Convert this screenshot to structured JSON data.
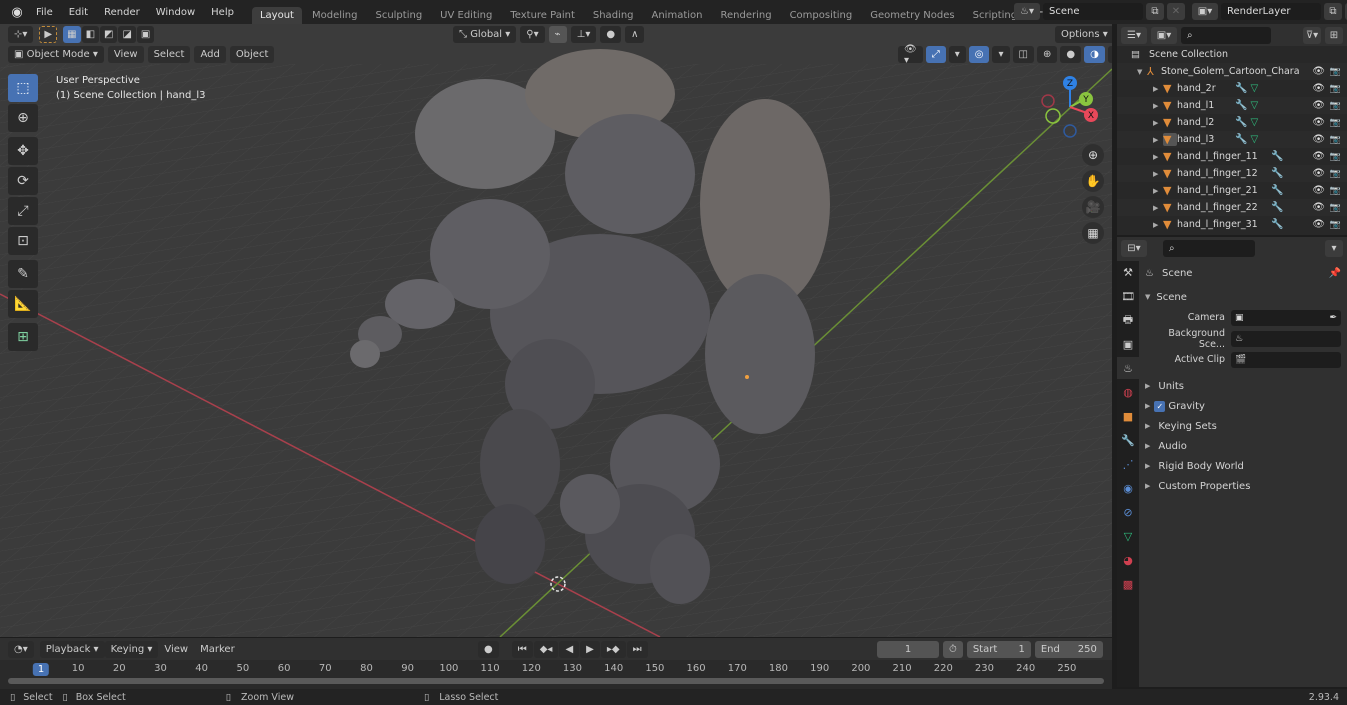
{
  "topbar": {
    "logo": "blender-logo",
    "menus": [
      "File",
      "Edit",
      "Render",
      "Window",
      "Help"
    ],
    "workspaces": [
      "Layout",
      "Modeling",
      "Sculpting",
      "UV Editing",
      "Texture Paint",
      "Shading",
      "Animation",
      "Rendering",
      "Compositing",
      "Geometry Nodes",
      "Scripting"
    ],
    "active_workspace": "Layout",
    "add_workspace": "+",
    "scene_name": "Scene",
    "view_layer": "RenderLayer"
  },
  "viewport": {
    "mode": "Object Mode",
    "menus": [
      "View",
      "Select",
      "Add",
      "Object"
    ],
    "transform_orientation": "Global",
    "options_label": "Options",
    "overlay_line1": "User Perspective",
    "overlay_line2": "(1) Scene Collection | hand_l3",
    "gizmo_axes": {
      "x": "X",
      "y": "Y",
      "z": "Z"
    },
    "axis_colors": {
      "x": "#e8485a",
      "y": "#8ac43f",
      "z": "#2f82e6"
    }
  },
  "outliner": {
    "root": "Scene Collection",
    "armature": "Stone_Golem_Cartoon_Chara",
    "items": [
      {
        "name": "hand_2r",
        "mods": true,
        "mesh": true
      },
      {
        "name": "hand_l1",
        "mods": true,
        "mesh": true
      },
      {
        "name": "hand_l2",
        "mods": true,
        "mesh": true
      },
      {
        "name": "hand_l3",
        "mods": true,
        "mesh": true,
        "active": true
      },
      {
        "name": "hand_l_finger_11",
        "mods": true,
        "mesh": false
      },
      {
        "name": "hand_l_finger_12",
        "mods": true,
        "mesh": false
      },
      {
        "name": "hand_l_finger_21",
        "mods": true,
        "mesh": false
      },
      {
        "name": "hand_l_finger_22",
        "mods": true,
        "mesh": false
      },
      {
        "name": "hand_l_finger_31",
        "mods": true,
        "mesh": false
      }
    ]
  },
  "properties": {
    "context_title": "Scene",
    "panel_title": "Scene",
    "fields": [
      {
        "label": "Camera",
        "value": ""
      },
      {
        "label": "Background Sce...",
        "value": ""
      },
      {
        "label": "Active Clip",
        "value": ""
      }
    ],
    "sections": [
      {
        "label": "Units",
        "checkbox": false
      },
      {
        "label": "Gravity",
        "checkbox": true,
        "checked": true
      },
      {
        "label": "Keying Sets",
        "checkbox": false
      },
      {
        "label": "Audio",
        "checkbox": false
      },
      {
        "label": "Rigid Body World",
        "checkbox": false
      },
      {
        "label": "Custom Properties",
        "checkbox": false
      }
    ]
  },
  "timeline": {
    "menus": [
      "Playback",
      "Keying",
      "View",
      "Marker"
    ],
    "current_frame": "1",
    "start_label": "Start",
    "start": "1",
    "end_label": "End",
    "end": "250",
    "ticks": [
      "10",
      "20",
      "30",
      "40",
      "50",
      "60",
      "70",
      "80",
      "90",
      "100",
      "110",
      "120",
      "130",
      "140",
      "150",
      "160",
      "170",
      "180",
      "190",
      "200",
      "210",
      "220",
      "230",
      "240",
      "250"
    ]
  },
  "statusbar": {
    "items": [
      "Select",
      "Box Select",
      "Zoom View",
      "Lasso Select"
    ],
    "version": "2.93.4"
  }
}
